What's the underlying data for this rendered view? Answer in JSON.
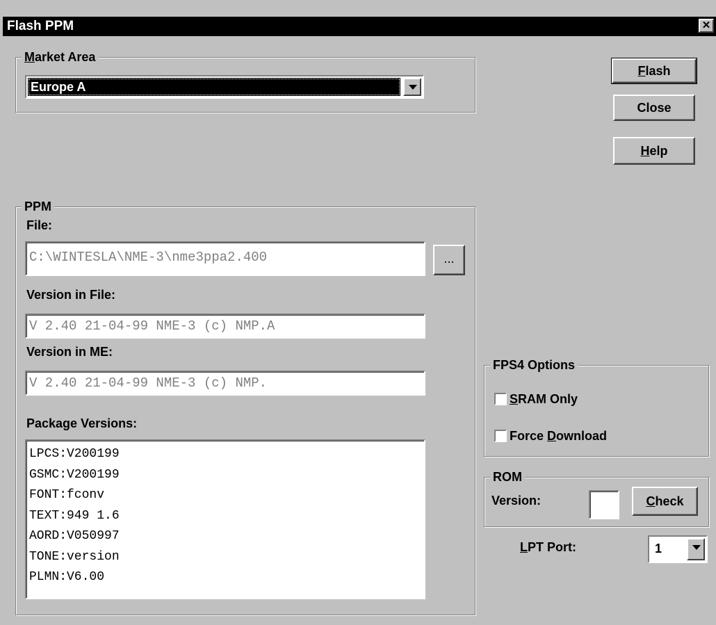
{
  "window": {
    "title": "Flash PPM",
    "close_glyph": "✕"
  },
  "market_area": {
    "label_underline": "M",
    "label_rest": "arket Area",
    "selected": "Europe A"
  },
  "buttons": {
    "flash_underline": "F",
    "flash_rest": "lash",
    "close": "Close",
    "help_underline": "H",
    "help_rest": "elp"
  },
  "ppm": {
    "group_label": "PPM",
    "file_label": "File:",
    "file_value": "C:\\WINTESLA\\NME-3\\nme3ppa2.400",
    "browse_label": "...",
    "version_in_file_label": "Version in File:",
    "version_in_file_value": "V  2.40 21-04-99 NME-3 (c) NMP.A",
    "version_in_me_label": "Version in ME:",
    "version_in_me_value": "V  2.40 21-04-99 NME-3 (c) NMP.",
    "package_versions_label": "Package Versions:",
    "package_versions": [
      "LPCS:V200199",
      "GSMC:V200199",
      "FONT:fconv",
      "TEXT:949 1.6",
      "AORD:V050997",
      "TONE:version",
      "PLMN:V6.00"
    ]
  },
  "fps4": {
    "group_label": "FPS4 Options",
    "sram_underline": "S",
    "sram_rest": "RAM Only",
    "force_before": "Force ",
    "force_underline": "D",
    "force_rest": "ownload",
    "sram_checked": false,
    "force_checked": false
  },
  "rom": {
    "group_label": "ROM",
    "version_label": "Version:",
    "version_value": "",
    "check_underline": "C",
    "check_rest": "heck"
  },
  "lpt": {
    "label_underline": "L",
    "label_rest": "PT Port:",
    "selected": "1"
  },
  "colors": {
    "face": "#c0c0c0",
    "titlebar": "#000000",
    "selection": "#000000",
    "disabled_text": "#808080"
  },
  "icons": {
    "dropdown": "chevron-down-icon",
    "close": "close-icon"
  }
}
